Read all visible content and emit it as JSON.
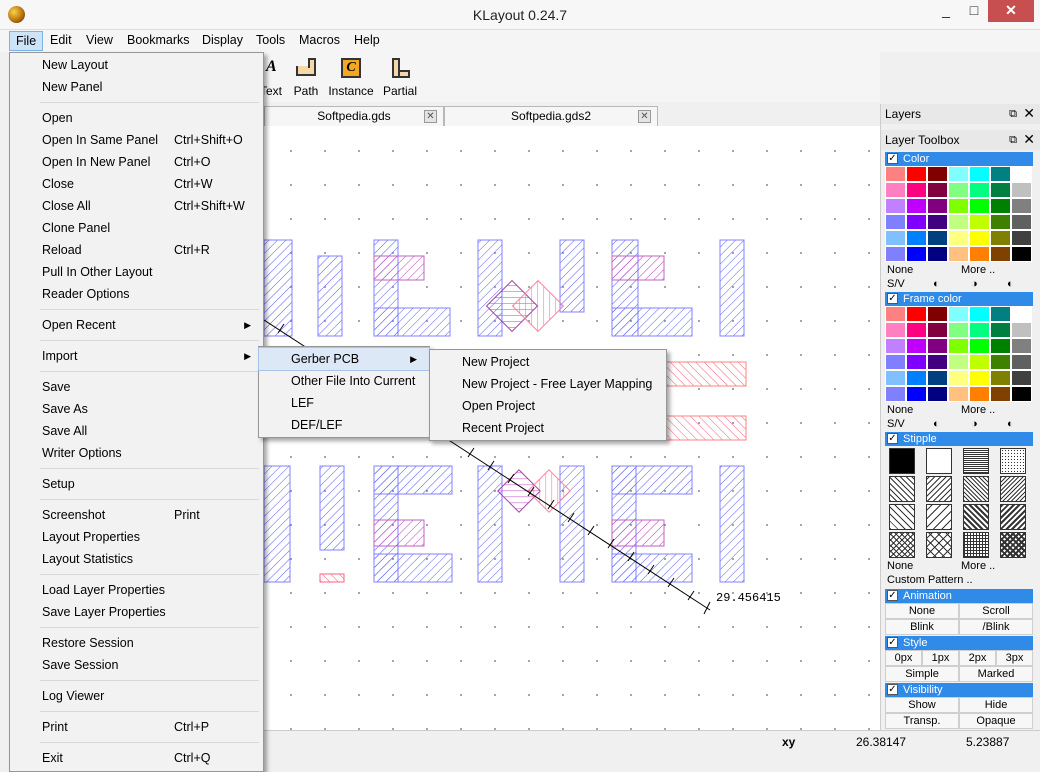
{
  "window": {
    "title": "KLayout 0.24.7",
    "min": "_",
    "max": "□",
    "close": "✕"
  },
  "menubar": [
    "File",
    "Edit",
    "View",
    "Bookmarks",
    "Display",
    "Tools",
    "Macros",
    "Help"
  ],
  "toolbar": {
    "text": "Text",
    "path": "Path",
    "instance": "Instance",
    "partial": "Partial"
  },
  "tabs": [
    {
      "label": "Softpedia.gds"
    },
    {
      "label": "Softpedia.gds2"
    }
  ],
  "ruler": {
    "value": "29.456415"
  },
  "status": {
    "label": "xy",
    "x": "26.38147",
    "y": "5.23887"
  },
  "file_menu": [
    {
      "label": "New Layout",
      "sc": ""
    },
    {
      "label": "New Panel",
      "sc": ""
    },
    {
      "label": "Open",
      "sc": ""
    },
    {
      "label": "Open In Same Panel",
      "sc": "Ctrl+Shift+O"
    },
    {
      "label": "Open In New Panel",
      "sc": "Ctrl+O"
    },
    {
      "label": "Close",
      "sc": "Ctrl+W"
    },
    {
      "label": "Close All",
      "sc": "Ctrl+Shift+W"
    },
    {
      "label": "Clone Panel",
      "sc": ""
    },
    {
      "label": "Reload",
      "sc": "Ctrl+R"
    },
    {
      "label": "Pull In Other Layout",
      "sc": ""
    },
    {
      "label": "Reader Options",
      "sc": ""
    },
    {
      "label": "Open Recent",
      "sc": ""
    },
    {
      "label": "Import",
      "sc": ""
    },
    {
      "label": "Save",
      "sc": ""
    },
    {
      "label": "Save As",
      "sc": ""
    },
    {
      "label": "Save All",
      "sc": ""
    },
    {
      "label": "Writer Options",
      "sc": ""
    },
    {
      "label": "Setup",
      "sc": ""
    },
    {
      "label": "Screenshot",
      "sc": "Print"
    },
    {
      "label": "Layout Properties",
      "sc": ""
    },
    {
      "label": "Layout Statistics",
      "sc": ""
    },
    {
      "label": "Load Layer Properties",
      "sc": ""
    },
    {
      "label": "Save Layer Properties",
      "sc": ""
    },
    {
      "label": "Restore Session",
      "sc": ""
    },
    {
      "label": "Save Session",
      "sc": ""
    },
    {
      "label": "Log Viewer",
      "sc": ""
    },
    {
      "label": "Print",
      "sc": "Ctrl+P"
    },
    {
      "label": "Exit",
      "sc": "Ctrl+Q"
    }
  ],
  "import_menu": [
    "Gerber PCB",
    "Other File Into Current",
    "LEF",
    "DEF/LEF"
  ],
  "gerber_menu": [
    "New Project",
    "New Project - Free Layer Mapping",
    "Open Project",
    "Recent Project"
  ],
  "dock": {
    "layers": "Layers",
    "toolbox": "Layer Toolbox",
    "color": "Color",
    "frame_color": "Frame color",
    "stipple": "Stipple",
    "animation": "Animation",
    "style": "Style",
    "visibility": "Visibility",
    "none": "None",
    "more": "More ..",
    "sv": "S/V",
    "custom_pattern": "Custom Pattern ..",
    "anim": [
      "None",
      "Scroll",
      "Blink",
      "/Blink"
    ],
    "style_px": [
      "0px",
      "1px",
      "2px",
      "3px"
    ],
    "style_mode": [
      "Simple",
      "Marked"
    ],
    "vis": [
      "Show",
      "Hide",
      "Transp.",
      "Opaque"
    ],
    "palette": [
      "#ff8080",
      "#ff0000",
      "#800000",
      "#80ffff",
      "#00ffff",
      "#008080",
      "#ffffff",
      "#ff80c0",
      "#ff0080",
      "#800040",
      "#80ff80",
      "#00ff80",
      "#008040",
      "#c0c0c0",
      "#c080ff",
      "#c000ff",
      "#800080",
      "#80ff00",
      "#00ff00",
      "#008000",
      "#808080",
      "#8080ff",
      "#8000ff",
      "#400080",
      "#c0ff80",
      "#c0ff00",
      "#408000",
      "#606060",
      "#80c0ff",
      "#0080ff",
      "#004080",
      "#ffff80",
      "#ffff00",
      "#808000",
      "#404040",
      "#8080ff",
      "#0000ff",
      "#000080",
      "#ffc080",
      "#ff8000",
      "#804000",
      "#000000"
    ]
  }
}
